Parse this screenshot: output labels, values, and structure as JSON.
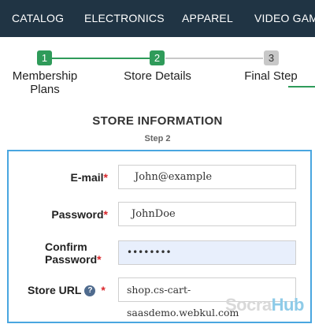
{
  "nav": {
    "items": [
      "CATALOG",
      "ELECTRONICS",
      "APPAREL",
      "VIDEO GAMES"
    ]
  },
  "stepper": {
    "steps": [
      {
        "number": "1",
        "label_line1": "Membership",
        "label_line2": "Plans",
        "state": "complete"
      },
      {
        "number": "2",
        "label_line1": "Store Details",
        "label_line2": "",
        "state": "current"
      },
      {
        "number": "3",
        "label_line1": "Final Step",
        "label_line2": "",
        "state": "upcoming"
      }
    ],
    "colors": {
      "complete": "#2f9b5a",
      "upcoming": "#c8c8c8"
    }
  },
  "section": {
    "title": "STORE INFORMATION",
    "subtitle": "Step 2"
  },
  "form": {
    "email_label": "E-mail",
    "email_value": "John@example",
    "password_label": "Password",
    "password_value": "JohnDoe",
    "confirm_label_line1": "Confirm",
    "confirm_label_line2": "Password",
    "confirm_value": "••••••••",
    "store_url_label": "Store URL",
    "store_url_value": "shop.cs-cart-saasdemo.webkul.com",
    "required_mark": "*",
    "help_icon_glyph": "?"
  },
  "watermark": {
    "part1": "Socra",
    "part2": "Hub"
  },
  "colors": {
    "nav_bg": "#203444",
    "accent_green": "#2f9b5a",
    "form_border": "#49a6e0",
    "required_red": "#d9262b"
  }
}
